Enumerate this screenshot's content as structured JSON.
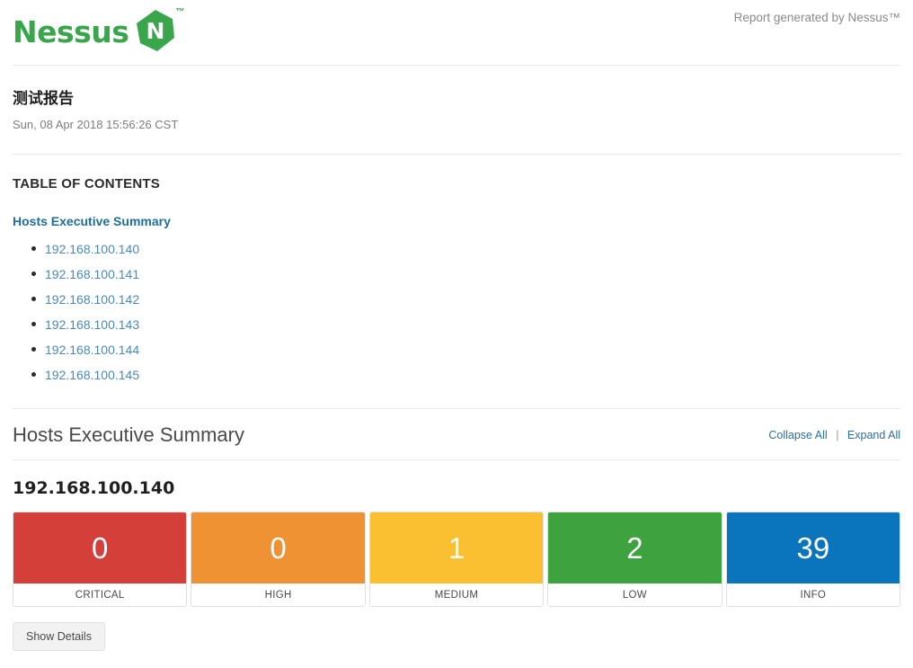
{
  "header": {
    "logo_text": "Nessus",
    "logo_letter": "N",
    "logo_tm": "™",
    "generated_by": "Report generated by Nessus™",
    "brand_color": "#3aa64c"
  },
  "report": {
    "title": "测试报告",
    "date": "Sun, 08 Apr 2018 15:56:26 CST"
  },
  "toc": {
    "heading": "TABLE OF CONTENTS",
    "section_link": "Hosts Executive Summary",
    "hosts": [
      "192.168.100.140",
      "192.168.100.141",
      "192.168.100.142",
      "192.168.100.143",
      "192.168.100.144",
      "192.168.100.145"
    ]
  },
  "summary": {
    "title": "Hosts Executive Summary",
    "collapse_all": "Collapse All",
    "separator": "|",
    "expand_all": "Expand All"
  },
  "host": {
    "name": "192.168.100.140",
    "show_details": "Show Details",
    "severities": [
      {
        "label": "CRITICAL",
        "count": "0",
        "color": "#d43f3a"
      },
      {
        "label": "HIGH",
        "count": "0",
        "color": "#ef9234"
      },
      {
        "label": "MEDIUM",
        "count": "1",
        "color": "#fbbf32"
      },
      {
        "label": "LOW",
        "count": "2",
        "color": "#3ea33e"
      },
      {
        "label": "INFO",
        "count": "39",
        "color": "#0a74bd"
      }
    ]
  }
}
